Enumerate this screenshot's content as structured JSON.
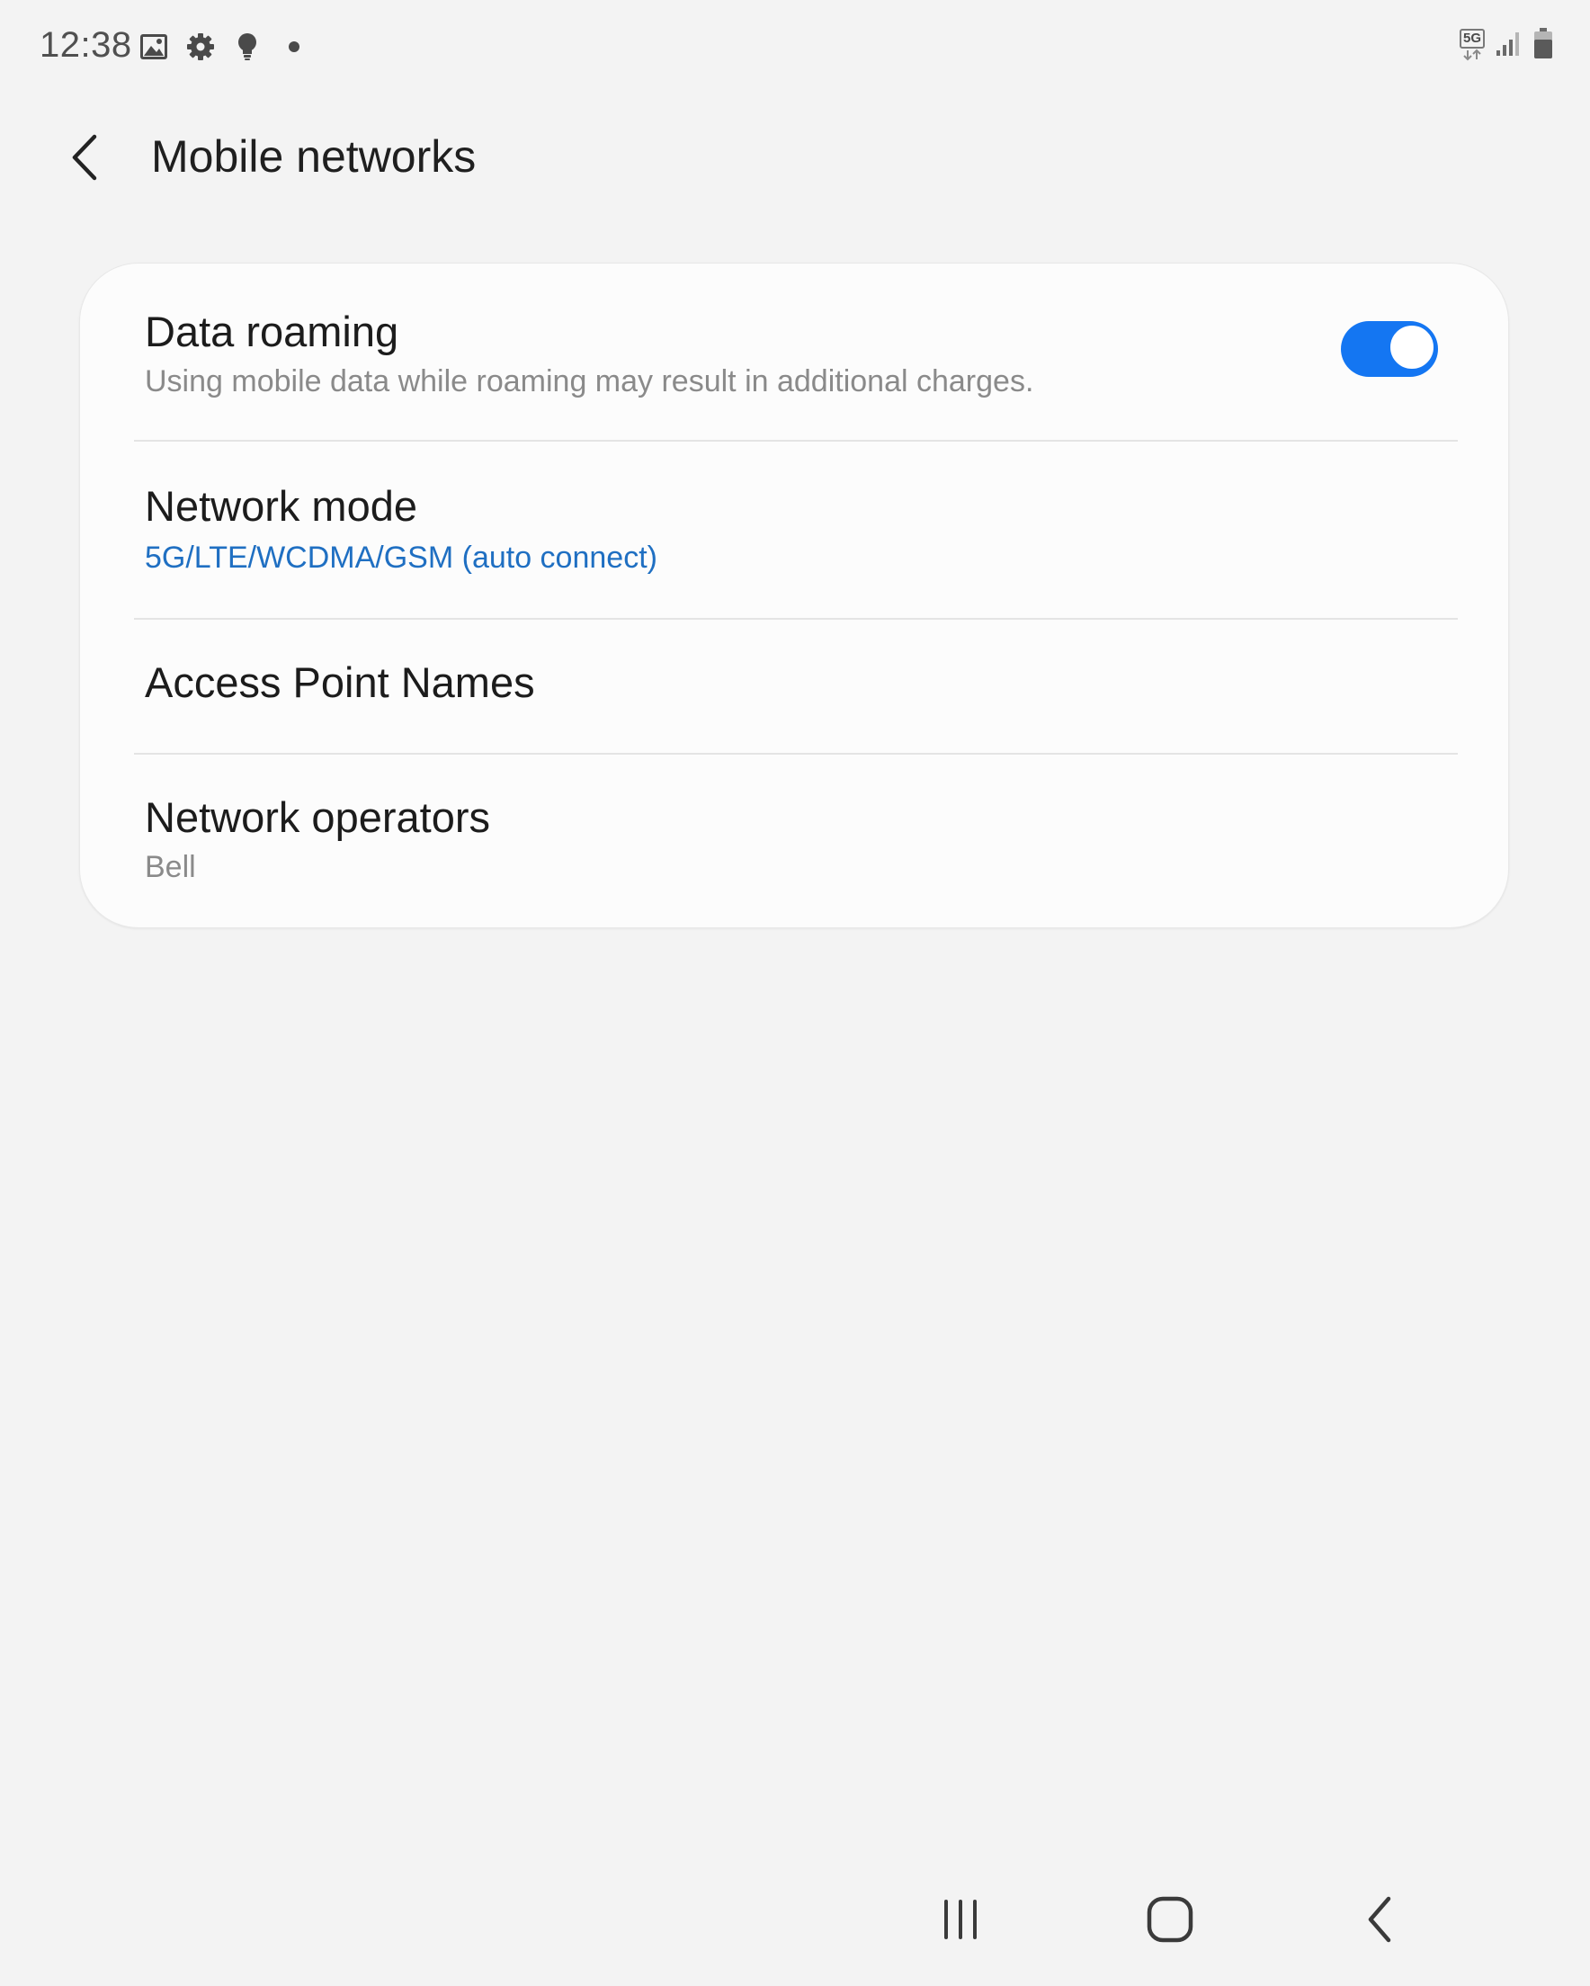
{
  "status_bar": {
    "time": "12:38",
    "left_icons": [
      "gallery-icon",
      "settings-gear-icon",
      "lightbulb-icon",
      "dot-icon"
    ],
    "network_badge": "5G",
    "right_icons": [
      "network-5g-icon",
      "signal-icon",
      "battery-icon"
    ]
  },
  "header": {
    "title": "Mobile networks",
    "back_icon": "chevron-left-icon"
  },
  "settings": {
    "data_roaming": {
      "title": "Data roaming",
      "subtitle": "Using mobile data while roaming may result in additional charges.",
      "enabled": true
    },
    "network_mode": {
      "title": "Network mode",
      "value": "5G/LTE/WCDMA/GSM (auto connect)"
    },
    "access_point_names": {
      "title": "Access Point Names"
    },
    "network_operators": {
      "title": "Network operators",
      "value": "Bell"
    }
  },
  "nav_bar": {
    "buttons": [
      "recent-apps-icon",
      "home-icon",
      "back-icon"
    ]
  },
  "colors": {
    "background": "#f3f3f3",
    "card": "#fcfcfc",
    "accent": "#1476f2",
    "link_text": "#1f6fc2",
    "secondary_text": "#8a8a8a"
  }
}
